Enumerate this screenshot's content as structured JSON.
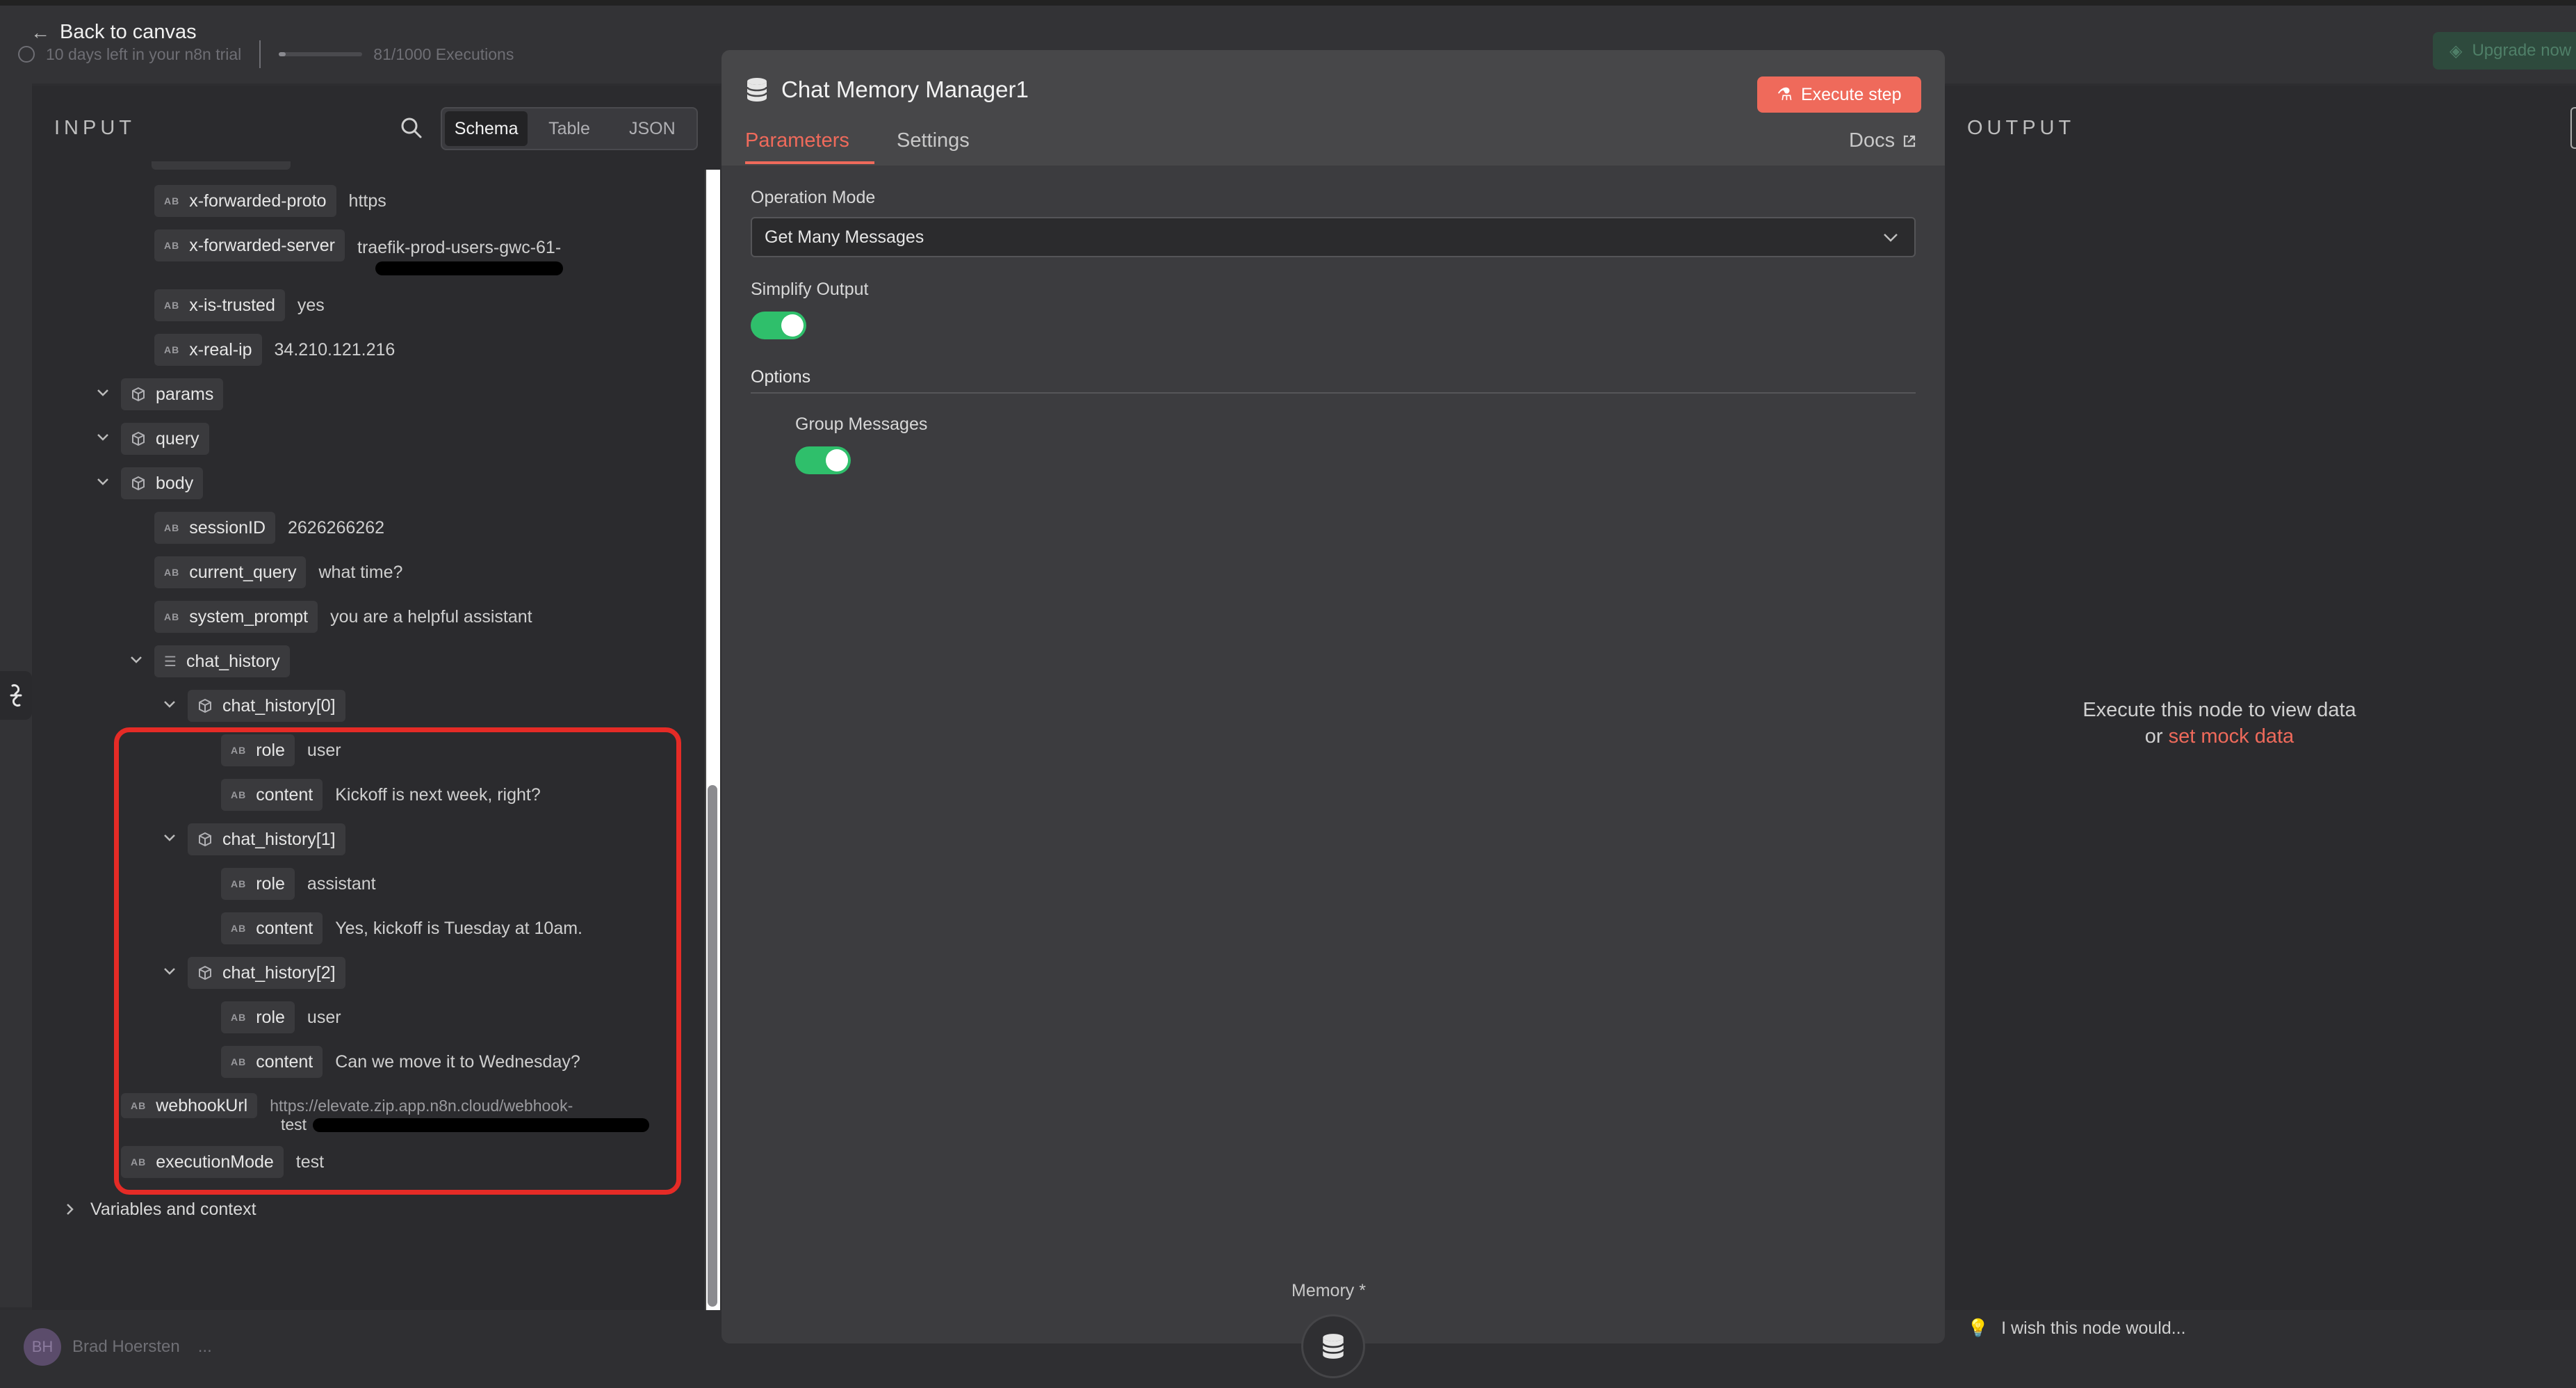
{
  "topbar": {
    "back_label": "Back to canvas",
    "trial_text": "10 days left in your n8n trial",
    "executions": "81/1000 Executions",
    "execution_progress": 0.081,
    "upgrade_label": "Upgrade now"
  },
  "input": {
    "title": "INPUT",
    "views": [
      "Schema",
      "Table",
      "JSON"
    ],
    "active_view": "Schema",
    "fields": {
      "x_forwarded_proto": {
        "key": "x-forwarded-proto",
        "value": "https"
      },
      "x_forwarded_server": {
        "key": "x-forwarded-server",
        "value": "traefik-prod-users-gwc-61-"
      },
      "x_is_trusted": {
        "key": "x-is-trusted",
        "value": "yes"
      },
      "x_real_ip": {
        "key": "x-real-ip",
        "value": "34.210.121.216"
      },
      "params": {
        "key": "params"
      },
      "query": {
        "key": "query"
      },
      "body": {
        "key": "body"
      },
      "session_id": {
        "key": "sessionID",
        "value": "2626266262"
      },
      "current_query": {
        "key": "current_query",
        "value": "what time?"
      },
      "system_prompt": {
        "key": "system_prompt",
        "value": "you are a helpful assistant"
      },
      "chat_history": {
        "key": "chat_history"
      },
      "ch0": {
        "key": "chat_history[0]",
        "role": "user",
        "content": "Kickoff is next week, right?"
      },
      "ch1": {
        "key": "chat_history[1]",
        "role": "assistant",
        "content": "Yes, kickoff is Tuesday at 10am."
      },
      "ch2": {
        "key": "chat_history[2]",
        "role": "user",
        "content": "Can we move it to Wednesday?"
      },
      "role_key": "role",
      "content_key": "content",
      "webhook_url": {
        "key": "webhookUrl",
        "value": "https://elevate.zip.app.n8n.cloud/webhook-",
        "value2": "test"
      },
      "execution_mode": {
        "key": "executionMode",
        "value": "test"
      },
      "type_badge": "AB",
      "variables": "Variables and context"
    }
  },
  "node": {
    "title": "Chat Memory Manager1",
    "execute_label": "Execute step",
    "tabs": [
      "Parameters",
      "Settings"
    ],
    "active_tab": "Parameters",
    "docs_label": "Docs",
    "operation_mode_label": "Operation Mode",
    "operation_mode_value": "Get Many Messages",
    "simplify_label": "Simplify Output",
    "simplify_on": true,
    "options_label": "Options",
    "group_label": "Group Messages",
    "group_on": true,
    "memory_label": "Memory *",
    "accent": "#ef6a5b",
    "toggle_color": "#2fbf6b"
  },
  "output": {
    "title": "OUTPUT",
    "message": "Execute this node to view data",
    "or": "or",
    "mock_link": "set mock data",
    "wish": "I wish this node would..."
  },
  "user": {
    "initials": "BH",
    "name": "Brad Hoersten",
    "more": "..."
  }
}
